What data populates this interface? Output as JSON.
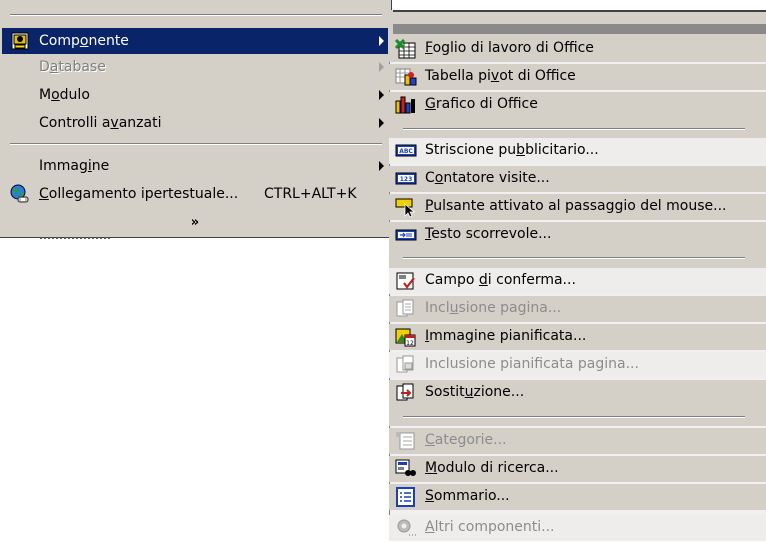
{
  "main_menu": {
    "items": [
      {
        "label_pre": "Comp",
        "label_u": "o",
        "label_post": "nente",
        "icon": "component-icon",
        "submenu": true
      },
      {
        "label_pre": "D",
        "label_u": "a",
        "label_post": "tabase",
        "submenu": true,
        "disabled": true
      },
      {
        "label_pre": "M",
        "label_u": "o",
        "label_post": "dulo",
        "submenu": true
      },
      {
        "label_pre": "Controlli a",
        "label_u": "v",
        "label_post": "anzati",
        "submenu": true
      },
      {
        "label_pre": "Immag",
        "label_u": "i",
        "label_post": "ne",
        "submenu": true
      },
      {
        "label_pre": "",
        "label_u": "C",
        "label_post": "ollegamento ipertestuale...",
        "shortcut": "CTRL+ALT+K",
        "icon": "hyperlink-globe-icon"
      }
    ],
    "expand_glyph": "»",
    "highlight_color": "#0a246a",
    "menu_color": "#d4d0c8"
  },
  "sub_menu": {
    "groups": [
      [
        {
          "label_pre": "",
          "label_u": "F",
          "label_post": "oglio di lavoro di Office",
          "icon": "spreadsheet-icon"
        },
        {
          "label_pre": "Tabella pi",
          "label_u": "v",
          "label_post": "ot di Office",
          "icon": "pivot-table-icon"
        },
        {
          "label_pre": "",
          "label_u": "G",
          "label_post": "rafico di Office",
          "icon": "chart-icon"
        }
      ],
      [
        {
          "label_pre": "Striscione pu",
          "label_u": "b",
          "label_post": "blicitario...",
          "icon": "banner-abc-icon",
          "hl": true
        },
        {
          "label_pre": "C",
          "label_u": "o",
          "label_post": "ntatore visite...",
          "icon": "hit-counter-icon"
        },
        {
          "label_pre": "",
          "label_u": "P",
          "label_post": "ulsante attivato al passaggio del mouse...",
          "icon": "hover-button-icon"
        },
        {
          "label_pre": "",
          "label_u": "T",
          "label_post": "esto scorrevole...",
          "icon": "marquee-icon"
        }
      ],
      [
        {
          "label_pre": "Campo ",
          "label_u": "d",
          "label_post": "i conferma...",
          "icon": "confirmation-field-icon",
          "hl": true
        },
        {
          "label_pre": "Incl",
          "label_u": "u",
          "label_post": "sione pagina...",
          "icon": "include-page-icon",
          "disabled": true
        },
        {
          "label_pre": "",
          "label_u": "I",
          "label_post": "mmagine pianificata...",
          "icon": "scheduled-picture-icon"
        },
        {
          "label_pre": "Inclusione pianificata pagina...",
          "label_u": "",
          "label_post": "",
          "icon": "scheduled-include-icon",
          "disabled": true,
          "hl": true
        },
        {
          "label_pre": "Sostit",
          "label_u": "u",
          "label_post": "zione...",
          "icon": "substitution-icon"
        }
      ],
      [
        {
          "label_pre": "",
          "label_u": "C",
          "label_post": "ategorie...",
          "icon": "categories-icon",
          "disabled": true
        },
        {
          "label_pre": "",
          "label_u": "M",
          "label_post": "odulo di ricerca...",
          "icon": "search-form-icon"
        },
        {
          "label_pre": "",
          "label_u": "S",
          "label_post": "ommario...",
          "icon": "table-of-contents-icon"
        },
        {
          "label_pre": "",
          "label_u": "A",
          "label_post": "ltri componenti...",
          "icon": "more-components-icon",
          "disabled": true,
          "hl": true
        }
      ]
    ]
  }
}
